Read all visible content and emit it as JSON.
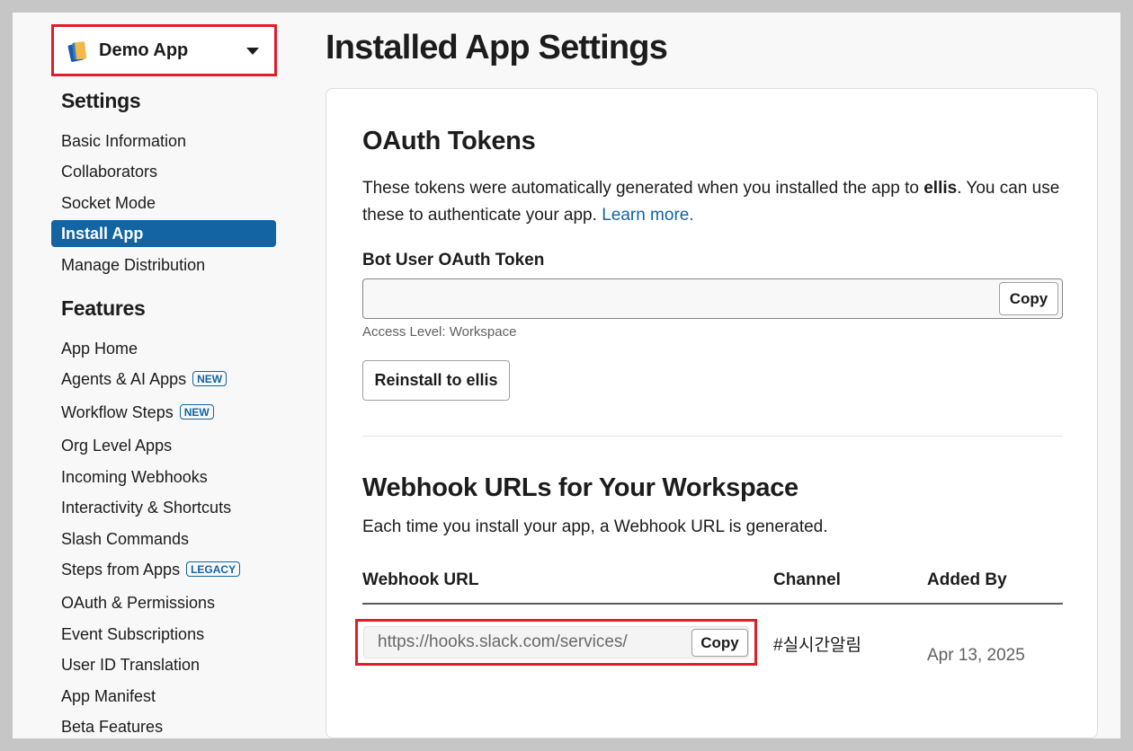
{
  "app_selector": {
    "name": "Demo App"
  },
  "sidebar": {
    "settings_heading": "Settings",
    "settings_items": [
      {
        "label": "Basic Information"
      },
      {
        "label": "Collaborators"
      },
      {
        "label": "Socket Mode"
      },
      {
        "label": "Install App",
        "active": true
      },
      {
        "label": "Manage Distribution"
      }
    ],
    "features_heading": "Features",
    "features_items": [
      {
        "label": "App Home"
      },
      {
        "label": "Agents & AI Apps",
        "badge": "NEW"
      },
      {
        "label": "Workflow Steps",
        "badge": "NEW"
      },
      {
        "label": "Org Level Apps"
      },
      {
        "label": "Incoming Webhooks"
      },
      {
        "label": "Interactivity & Shortcuts"
      },
      {
        "label": "Slash Commands"
      },
      {
        "label": "Steps from Apps",
        "badge": "LEGACY"
      },
      {
        "label": "OAuth & Permissions"
      },
      {
        "label": "Event Subscriptions"
      },
      {
        "label": "User ID Translation"
      },
      {
        "label": "App Manifest"
      },
      {
        "label": "Beta Features"
      }
    ]
  },
  "page": {
    "title": "Installed App Settings"
  },
  "oauth": {
    "heading": "OAuth Tokens",
    "desc_pre": "These tokens were automatically generated when you installed the app to ",
    "workspace": "ellis",
    "desc_post": ". You can use these to authenticate your app. ",
    "learn_more": "Learn more.",
    "bot_token_label": "Bot User OAuth Token",
    "bot_token_value": "",
    "copy_label": "Copy",
    "access_level": "Access Level: Workspace",
    "reinstall_label": "Reinstall to ellis"
  },
  "webhooks": {
    "heading": "Webhook URLs for Your Workspace",
    "desc": "Each time you install your app, a Webhook URL is generated.",
    "columns": [
      "Webhook URL",
      "Channel",
      "Added By"
    ],
    "rows": [
      {
        "url": "https://hooks.slack.com/services/",
        "copy_label": "Copy",
        "channel": "#실시간알림",
        "added_by": "Apr 13, 2025"
      }
    ]
  },
  "colors": {
    "accent": "#1264a3",
    "highlight": "#e01e2b"
  }
}
